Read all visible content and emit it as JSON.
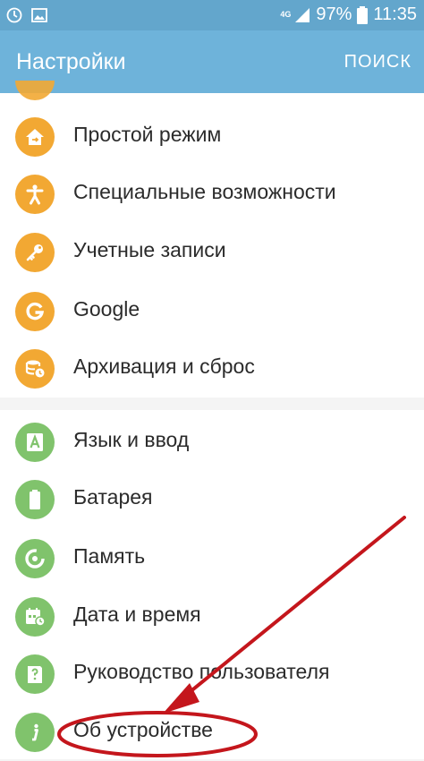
{
  "status_bar": {
    "network": "4G",
    "battery": "97%",
    "time": "11:35"
  },
  "app_bar": {
    "title": "Настройки",
    "search_label": "ПОИСК"
  },
  "settings_group_1": [
    {
      "label": "Простой режим",
      "icon": "home-icon"
    },
    {
      "label": "Специальные возможности",
      "icon": "accessibility-icon"
    },
    {
      "label": "Учетные записи",
      "icon": "key-icon"
    },
    {
      "label": "Google",
      "icon": "google-icon"
    },
    {
      "label": "Архивация и сброс",
      "icon": "backup-icon"
    }
  ],
  "settings_group_2": [
    {
      "label": "Язык и ввод",
      "icon": "language-icon"
    },
    {
      "label": "Батарея",
      "icon": "battery-icon"
    },
    {
      "label": "Память",
      "icon": "storage-icon"
    },
    {
      "label": "Дата и время",
      "icon": "calendar-icon"
    },
    {
      "label": "Руководство пользователя",
      "icon": "user-manual-icon"
    },
    {
      "label": "Об устройстве",
      "icon": "info-icon"
    }
  ],
  "colors": {
    "status_bar": "#63a6cc",
    "app_bar": "#6eb3da",
    "icon_orange": "#f2a833",
    "icon_green": "#80c36c",
    "annotation_red": "#c4161c"
  }
}
